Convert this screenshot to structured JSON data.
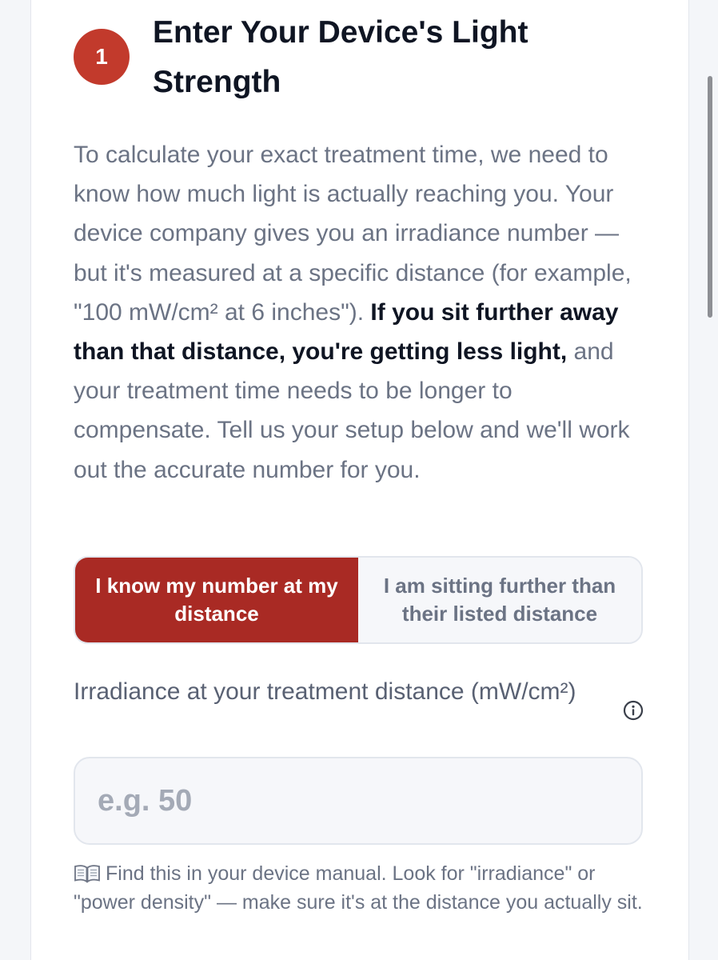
{
  "step": {
    "number": "1",
    "title": "Enter Your Device's Light Strength"
  },
  "description": {
    "part1": "To calculate your exact treatment time, we need to know how much light is actually reaching you. Your device company gives you an irradiance number — but it's measured at a specific distance (for example, \"100 mW/cm² at 6 inches\"). ",
    "bold": "If you sit further away than that distance, you're getting less light,",
    "part2": " and your treatment time needs to be longer to compensate. Tell us your setup below and we'll work out the accurate number for you."
  },
  "toggle": {
    "options": [
      {
        "label": "I know my number at my distance",
        "active": true
      },
      {
        "label": "I am sitting further than their listed distance",
        "active": false
      }
    ]
  },
  "irradiance_field": {
    "label": "Irradiance at your treatment distance (mW/cm²)",
    "placeholder": "e.g. 50",
    "value": ""
  },
  "hint": {
    "icon": "open-book-icon",
    "text": "Find this in your device manual. Look for \"irradiance\" or \"power density\" — make sure it's at the distance you actually sit."
  },
  "colors": {
    "accent": "#a92a24",
    "badge": "#c23a2c",
    "heading": "#0f1523",
    "muted_text": "#6b7384",
    "border": "#e2e6ed"
  }
}
